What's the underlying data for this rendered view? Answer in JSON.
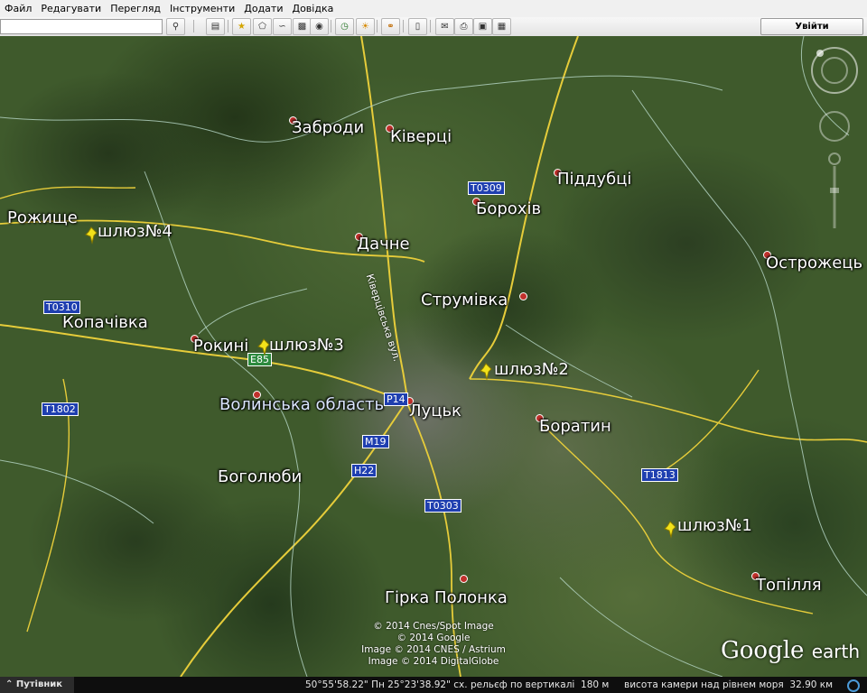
{
  "menu": [
    "Файл",
    "Редагувати",
    "Перегляд",
    "Інструменти",
    "Додати",
    "Довідка"
  ],
  "toolbar": {
    "sign_in": "Увійти",
    "icons": [
      "search-icon",
      "sidebar-icon",
      "placemark-icon",
      "polygon-icon",
      "path-icon",
      "overlay-icon",
      "tour-icon",
      "historical-imagery-icon",
      "sunlight-icon",
      "planets-icon",
      "ruler-icon",
      "email-icon",
      "print-icon",
      "save-image-icon",
      "maps-icon"
    ]
  },
  "places": {
    "zabrody": "Заброди",
    "kivertsi": "Ківерці",
    "piddubtsi": "Піддубці",
    "borokhiv": "Борохів",
    "rozhyshche": "Рожище",
    "dachne": "Дачне",
    "ostrozhets": "Острожець",
    "strumivka": "Струмівка",
    "kopachivka": "Копачівка",
    "rokyni": "Рокині",
    "volyn_oblast": "Волинська область",
    "lutsk": "Луцьк",
    "boratyn": "Боратин",
    "boholiuby": "Боголюби",
    "topillia": "Топілля",
    "hirka_polonka": "Гірка Полонка"
  },
  "placemarks": {
    "sluice1": "шлюз№1",
    "sluice2": "шлюз№2",
    "sluice3": "шлюз№3",
    "sluice4": "шлюз№4"
  },
  "roads": {
    "t0309": "T0309",
    "t0310": "T0310",
    "e85": "E85",
    "t1802": "T1802",
    "r14": "P14",
    "m19": "M19",
    "h22": "H22",
    "t0303": "T0303",
    "t1813": "T1813"
  },
  "street": "Ківерцівська вул.",
  "copyright": [
    "© 2014 Cnes/Spot Image",
    "© 2014 Google",
    "Image © 2014 CNES / Astrium",
    "Image © 2014 DigitalGlobe"
  ],
  "logo": {
    "google": "Google",
    "earth": "earth"
  },
  "status": {
    "guide": "Путівник",
    "coordinates": "50°55'58.22\" Пн  25°23'38.92\" сх.",
    "elevation_label": "рельєф по вертикалі",
    "elevation_value": "180 м",
    "eye_alt_label": "висота камери над рівнем моря",
    "eye_alt_value": "32.90 км"
  }
}
